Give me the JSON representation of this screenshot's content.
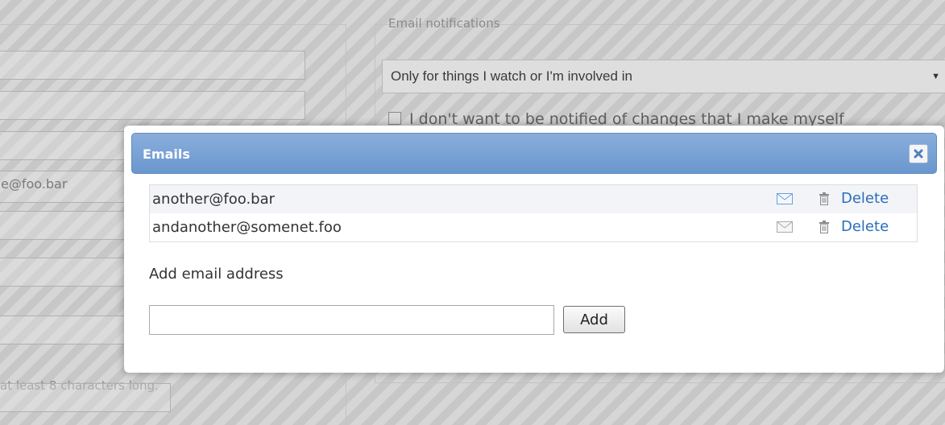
{
  "background": {
    "email_notifications_legend": "Email notifications",
    "notification_select_value": "Only for things I watch or I'm involved in",
    "self_changes_checkbox_label": "I don't want to be notified of changes that I make myself",
    "primary_email_value": "e@foo.bar",
    "password_hint": "at least 8 characters long."
  },
  "dialog": {
    "title": "Emails",
    "close_icon": "close-icon",
    "emails": [
      {
        "address": "another@foo.bar",
        "delete_label": "Delete",
        "notify_icon_active": true
      },
      {
        "address": "andanother@somenet.foo",
        "delete_label": "Delete",
        "notify_icon_active": false
      }
    ],
    "add_label": "Add email address",
    "add_input_value": "",
    "add_input_placeholder": "",
    "add_button_label": "Add"
  },
  "colors": {
    "titlebar": "#7aa2d6",
    "link": "#2a6ebb",
    "mail_icon_active": "#6d9fd8",
    "mail_icon_inactive": "#a9a9a9"
  }
}
